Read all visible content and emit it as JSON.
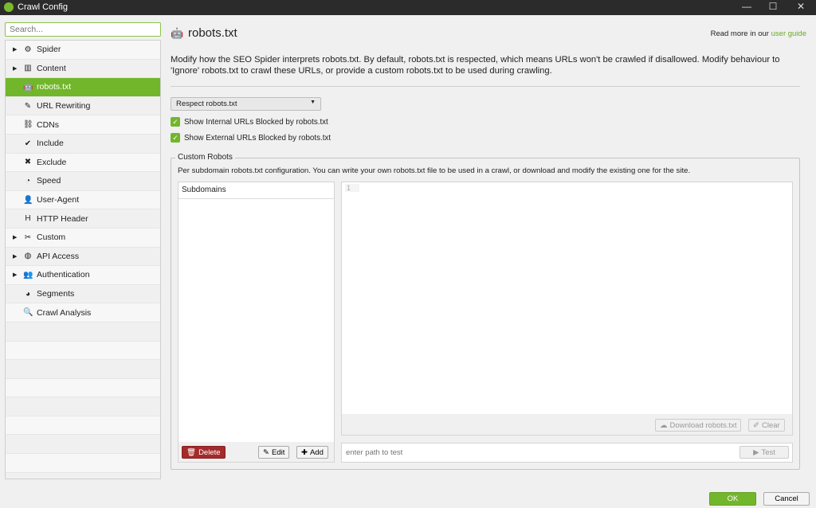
{
  "window": {
    "title": "Crawl Config",
    "minimize": "—",
    "maximize": "☐",
    "close": "✕"
  },
  "search": {
    "placeholder": "Search..."
  },
  "sidebar": {
    "items": [
      {
        "label": "Spider",
        "icon": "⚙",
        "expandable": true
      },
      {
        "label": "Content",
        "icon": "▥",
        "expandable": true
      },
      {
        "label": "robots.txt",
        "icon": "🤖",
        "expandable": false,
        "selected": true
      },
      {
        "label": "URL Rewriting",
        "icon": "✎",
        "expandable": false
      },
      {
        "label": "CDNs",
        "icon": "⛓",
        "expandable": false
      },
      {
        "label": "Include",
        "icon": "✔",
        "expandable": false
      },
      {
        "label": "Exclude",
        "icon": "✖",
        "expandable": false
      },
      {
        "label": "Speed",
        "icon": "◔",
        "expandable": false
      },
      {
        "label": "User-Agent",
        "icon": "👤",
        "expandable": false
      },
      {
        "label": "HTTP Header",
        "icon": "H",
        "expandable": false
      },
      {
        "label": "Custom",
        "icon": "✂",
        "expandable": true
      },
      {
        "label": "API Access",
        "icon": "◍",
        "expandable": true
      },
      {
        "label": "Authentication",
        "icon": "👥",
        "expandable": true
      },
      {
        "label": "Segments",
        "icon": "◕",
        "expandable": false
      },
      {
        "label": "Crawl Analysis",
        "icon": "🔍",
        "expandable": false
      }
    ]
  },
  "main": {
    "title": "robots.txt",
    "read_more_prefix": "Read more in our ",
    "read_more_link": "user guide",
    "description": "Modify how the SEO Spider interprets robots.txt. By default, robots.txt is respected, which means URLs won't be crawled if disallowed. Modify behaviour to 'Ignore' robots.txt to crawl these URLs, or provide a custom robots.txt to be used during crawling.",
    "mode_select": "Respect robots.txt",
    "show_internal": "Show Internal URLs Blocked by robots.txt",
    "show_external": "Show External URLs Blocked by robots.txt",
    "custom": {
      "legend": "Custom Robots",
      "description": "Per subdomain robots.txt configuration. You can write your own robots.txt file to be used in a crawl, or download and modify the existing one for the site.",
      "subdomains_header": "Subdomains",
      "line_number": "1",
      "delete": "Delete",
      "edit": "Edit",
      "add": "Add",
      "download": "Download robots.txt",
      "clear": "Clear",
      "test_placeholder": "enter path to test",
      "test": "Test"
    }
  },
  "footer": {
    "ok": "OK",
    "cancel": "Cancel"
  },
  "colors": {
    "accent": "#72b62b",
    "delete": "#a52a2a",
    "titlebar": "#2b2b2b"
  }
}
